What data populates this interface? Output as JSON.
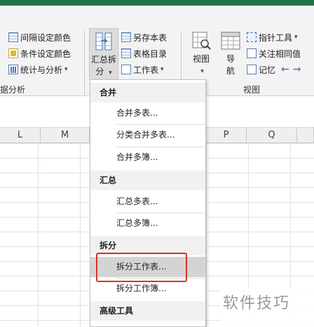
{
  "ribbon": {
    "left_group": {
      "items": [
        {
          "label": "间隔设定颜色",
          "icon": "interval-color-icon"
        },
        {
          "label": "条件设定颜色",
          "icon": "condition-color-icon"
        },
        {
          "label": "统计与分析",
          "icon": "statistics-icon"
        }
      ],
      "group_label": "据分析"
    },
    "summary_split": {
      "line1": "汇总拆",
      "line2": "分"
    },
    "mid_group": {
      "items": [
        {
          "label": "另存本表",
          "icon": "save-sheet-icon"
        },
        {
          "label": "表格目录",
          "icon": "table-catalog-icon"
        },
        {
          "label": "工作表",
          "icon": "worksheet-icon"
        }
      ]
    },
    "view_group": {
      "view_label": "视图",
      "nav_line1": "导",
      "nav_line2": "航",
      "items": [
        {
          "label": "指针工具",
          "icon": "pointer-tool-icon"
        },
        {
          "label": "关注相同值",
          "icon": "same-value-icon"
        },
        {
          "label": "记忆",
          "icon": "memory-icon"
        }
      ],
      "group_label": "视图"
    }
  },
  "columns": [
    "L",
    "M",
    "P",
    "Q"
  ],
  "menu": {
    "sections": [
      {
        "header": "合并",
        "items": [
          "合并多表...",
          "分类合并多表...",
          "合并多簿..."
        ]
      },
      {
        "header": "汇总",
        "items": [
          "汇总多表...",
          "汇总多簿..."
        ]
      },
      {
        "header": "拆分",
        "items": [
          "拆分工作表...",
          "拆分工作簿..."
        ]
      },
      {
        "header": "高级工具",
        "items": []
      }
    ]
  },
  "watermark": "软件技巧",
  "colors": {
    "accent": "#217346",
    "highlight": "#d9322b",
    "hover": "#d4d4d4"
  }
}
